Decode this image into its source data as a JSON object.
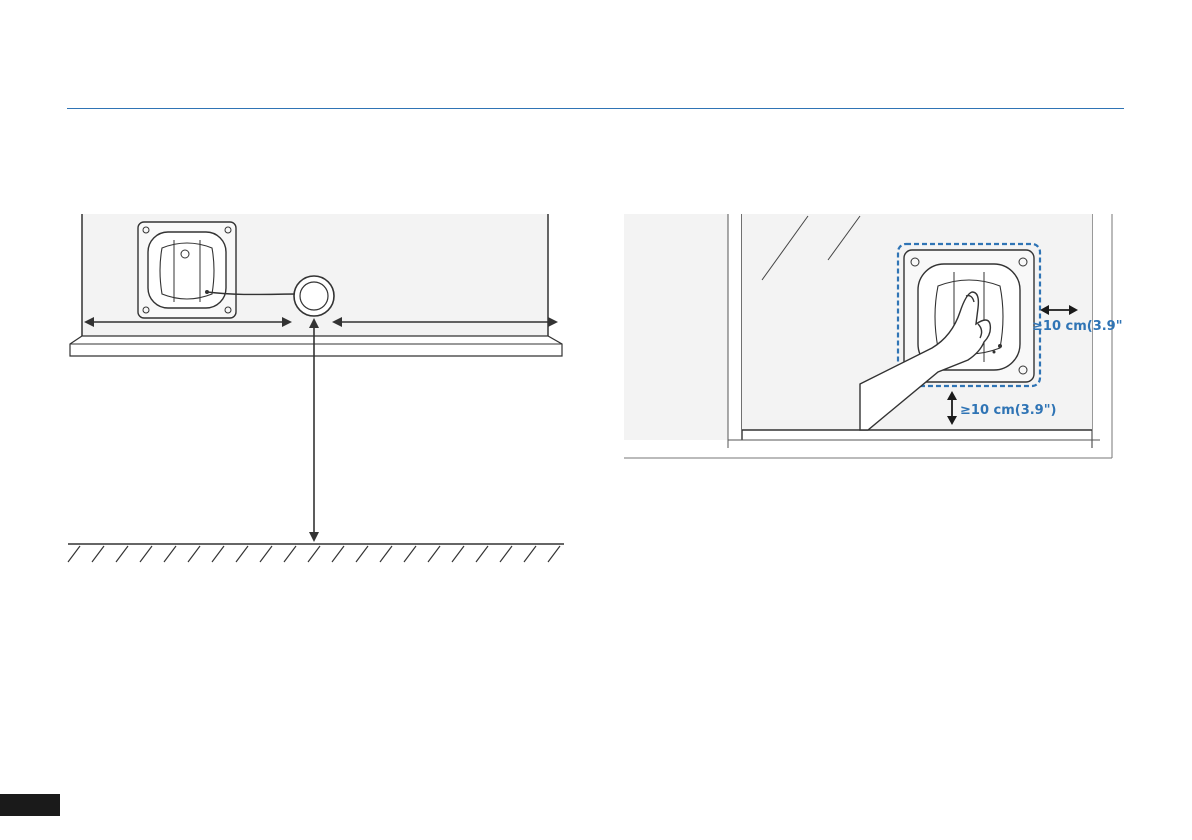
{
  "page": {
    "accent_color": "#2f74b5",
    "line_color": "#3a3a3a",
    "wall_color": "#f3f3f3"
  },
  "figure_right": {
    "side_clearance_label": "≥10 cm(3.9\")",
    "bottom_clearance_label": "≥10 cm(3.9\")"
  },
  "page_tab": {
    "color": "#1a1a1a"
  }
}
